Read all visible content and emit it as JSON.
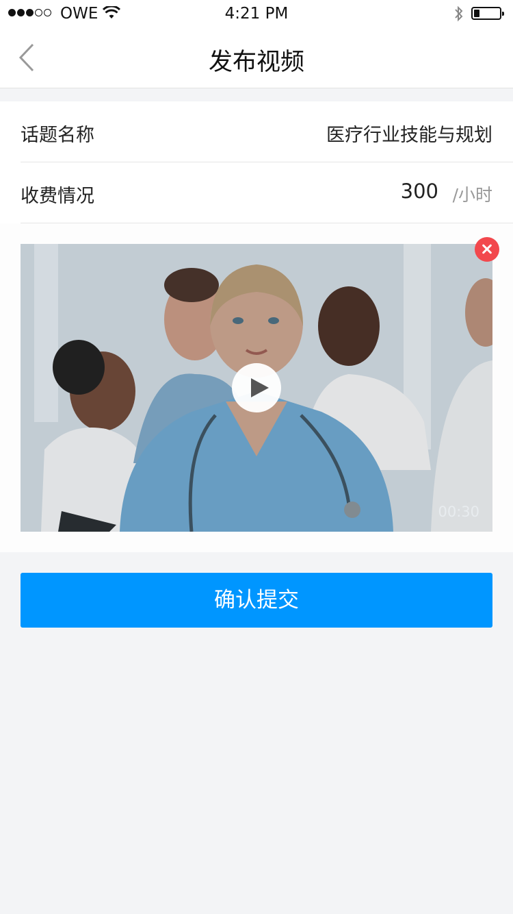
{
  "status_bar": {
    "carrier": "OWE",
    "time": "4:21 PM",
    "signal_bars_filled": 3,
    "signal_bars_total": 5,
    "battery_level": 0.18
  },
  "nav": {
    "title": "发布视频",
    "back_icon": "chevron-left-icon"
  },
  "form": {
    "topic_label": "话题名称",
    "topic_value": "医疗行业技能与规划",
    "fee_label": "收费情况",
    "fee_value": "300",
    "fee_unit": "/小时"
  },
  "video": {
    "duration": "00:30",
    "play_icon": "play-icon",
    "remove_icon": "close-icon"
  },
  "actions": {
    "submit_label": "确认提交"
  },
  "colors": {
    "primary": "#0096ff",
    "remove": "#f2484d",
    "background": "#f3f4f6"
  }
}
